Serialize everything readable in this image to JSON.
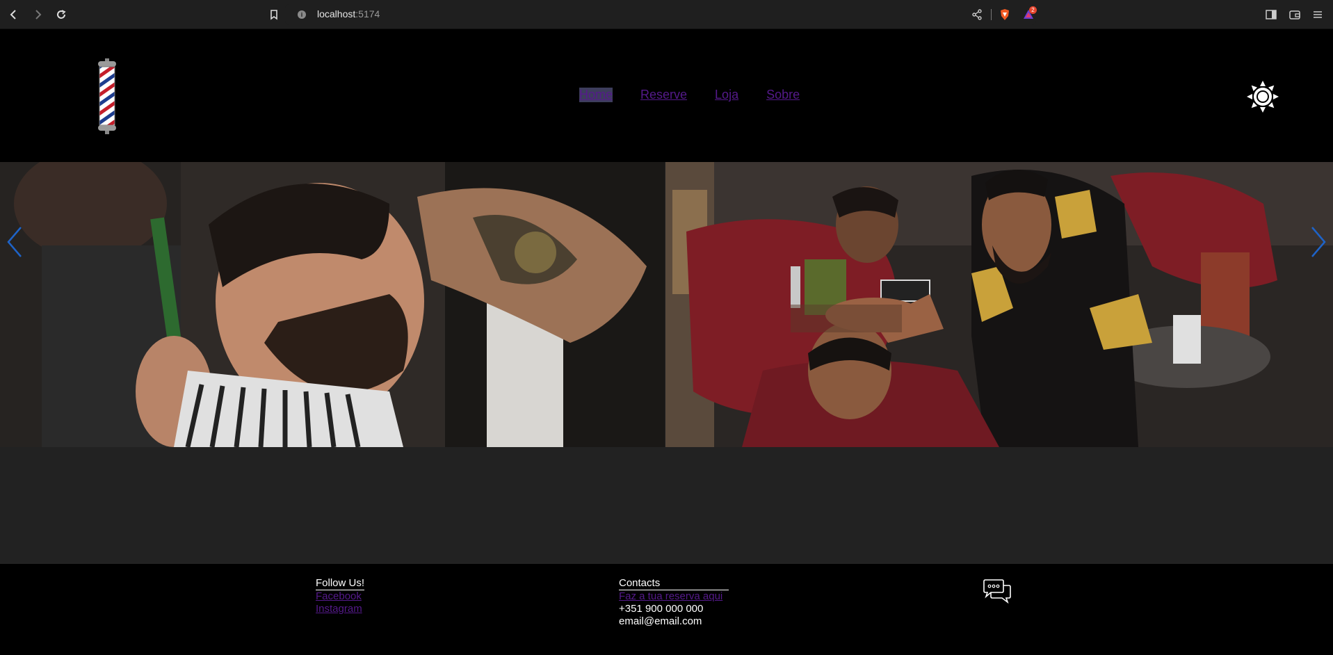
{
  "browser": {
    "url_host": "localhost",
    "url_port": ":5174",
    "badge_count": "2",
    "icons": [
      "back-icon",
      "forward-icon",
      "reload-icon",
      "bookmark-icon",
      "site-info-icon",
      "share-icon",
      "brave-shields-icon",
      "brave-rewards-icon",
      "sidebar-icon",
      "wallet-icon",
      "menu-icon"
    ]
  },
  "header": {
    "logo": "barber-pole-logo",
    "nav": [
      {
        "label": "Home",
        "active": true
      },
      {
        "label": "Reserve",
        "active": false
      },
      {
        "label": "Loja",
        "active": false
      },
      {
        "label": "Sobre",
        "active": false
      }
    ],
    "theme_toggle_icon": "sun-icon"
  },
  "carousel": {
    "slides": [
      {
        "description_icon": "barber-photo"
      },
      {
        "description_icon": "barbershop-photo"
      }
    ],
    "arrow_color": "#1e63c8"
  },
  "footer": {
    "follow": {
      "heading": "Follow Us!",
      "links": [
        "Facebook",
        "Instagram"
      ]
    },
    "contacts": {
      "heading": "Contacts",
      "reservation_link": "Faz a tua reserva aqui",
      "phone": "+351 900 000 000",
      "email": "email@email.com"
    },
    "chat_icon": "chat-bubbles-icon"
  },
  "colors": {
    "link": "#551a8b",
    "header_bg": "#000000",
    "body_bg": "#222222"
  }
}
